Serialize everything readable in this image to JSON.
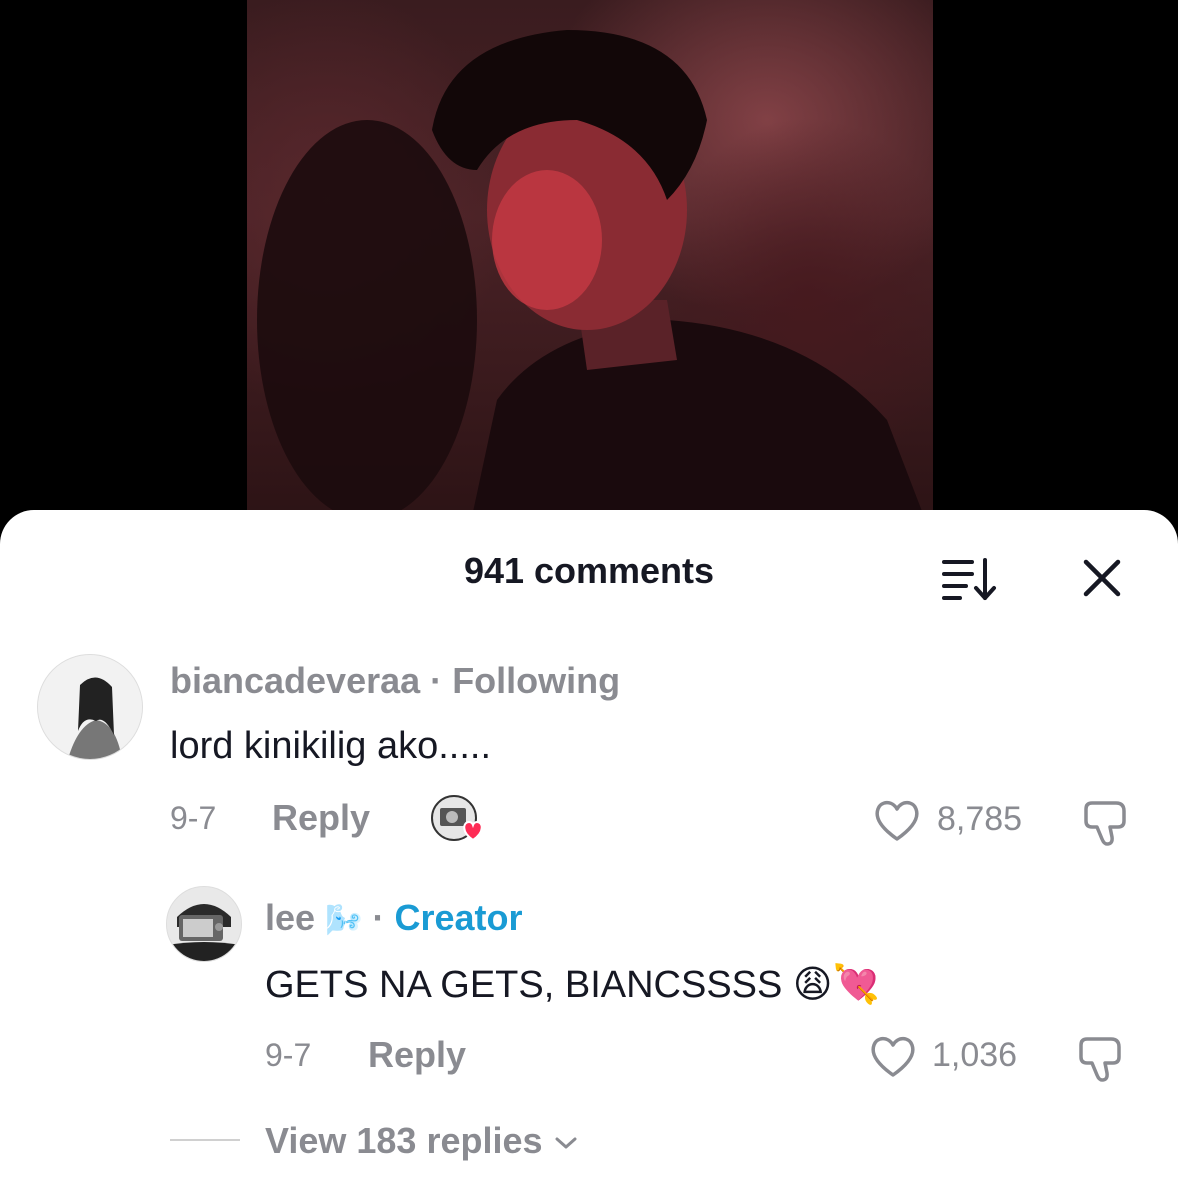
{
  "sheet": {
    "comment_count_label": "941 comments"
  },
  "comments": [
    {
      "username": "biancadeveraa",
      "separator": "·",
      "relation": "Following",
      "text": "lord kinikilig ako.....",
      "date": "9-7",
      "reply_label": "Reply",
      "likes": "8,785"
    }
  ],
  "reply": {
    "username": "lee",
    "separator": "·",
    "badge": "Creator",
    "text": "GETS NA GETS, BIANCSSSS 😩💘",
    "date": "9-7",
    "reply_label": "Reply",
    "likes": "1,036"
  },
  "view_replies_label": "View 183 replies",
  "colors": {
    "text_primary": "#161823",
    "text_secondary": "#8a8b91",
    "creator_badge": "#1a9bd4",
    "heart_red": "#fe2c55"
  },
  "icons": [
    "sort-icon",
    "close-icon",
    "heart-icon",
    "dislike-icon",
    "chevron-down-icon"
  ]
}
